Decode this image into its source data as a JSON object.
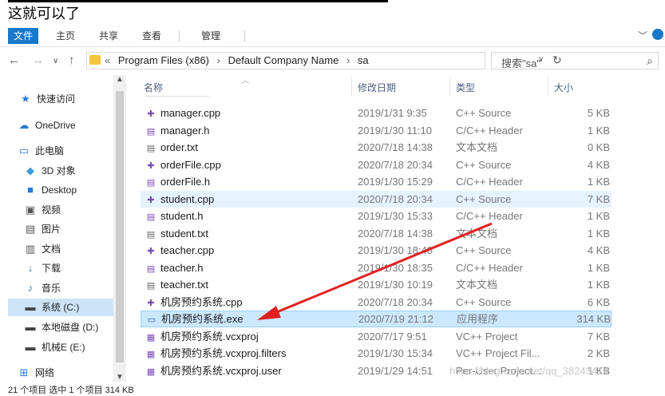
{
  "caption": "这就可以了",
  "ribbon": {
    "tabs": [
      "文件",
      "主页",
      "共享",
      "查看",
      "管理"
    ]
  },
  "address": {
    "crumbs": [
      "Program Files (x86)",
      "Default Company Name",
      "sa"
    ],
    "search_placeholder": "搜索\"sa\""
  },
  "nav": {
    "items": [
      {
        "label": "快速访问",
        "icon": "star-icon"
      },
      {
        "label": "OneDrive",
        "icon": "cloud-icon"
      },
      {
        "label": "此电脑",
        "icon": "computer-icon"
      },
      {
        "label": "3D 对象",
        "icon": "cube-icon"
      },
      {
        "label": "Desktop",
        "icon": "desktop-icon"
      },
      {
        "label": "视频",
        "icon": "video-icon"
      },
      {
        "label": "图片",
        "icon": "picture-icon"
      },
      {
        "label": "文档",
        "icon": "document-icon"
      },
      {
        "label": "下载",
        "icon": "download-icon"
      },
      {
        "label": "音乐",
        "icon": "music-icon"
      },
      {
        "label": "系统 (C:)",
        "icon": "drive-icon"
      },
      {
        "label": "本地磁盘 (D:)",
        "icon": "drive-icon"
      },
      {
        "label": "机械E (E:)",
        "icon": "drive-icon"
      },
      {
        "label": "网络",
        "icon": "network-icon"
      }
    ]
  },
  "columns": {
    "name": "名称",
    "date": "修改日期",
    "type": "类型",
    "size": "大小"
  },
  "files": [
    {
      "name": "manager.cpp",
      "date": "2019/1/31 9:35",
      "type": "C++ Source",
      "size": "5 KB",
      "icon": "cpp"
    },
    {
      "name": "manager.h",
      "date": "2019/1/30 11:10",
      "type": "C/C++ Header",
      "size": "1 KB",
      "icon": "h"
    },
    {
      "name": "order.txt",
      "date": "2020/7/18 14:38",
      "type": "文本文档",
      "size": "0 KB",
      "icon": "txt"
    },
    {
      "name": "orderFile.cpp",
      "date": "2020/7/18 20:34",
      "type": "C++ Source",
      "size": "4 KB",
      "icon": "cpp"
    },
    {
      "name": "orderFile.h",
      "date": "2019/1/30 15:29",
      "type": "C/C++ Header",
      "size": "1 KB",
      "icon": "h"
    },
    {
      "name": "student.cpp",
      "date": "2020/7/18 20:34",
      "type": "C++ Source",
      "size": "7 KB",
      "icon": "cpp"
    },
    {
      "name": "student.h",
      "date": "2019/1/30 15:33",
      "type": "C/C++ Header",
      "size": "1 KB",
      "icon": "h"
    },
    {
      "name": "student.txt",
      "date": "2020/7/18 14:38",
      "type": "文本文档",
      "size": "1 KB",
      "icon": "txt"
    },
    {
      "name": "teacher.cpp",
      "date": "2019/1/30 18:48",
      "type": "C++ Source",
      "size": "4 KB",
      "icon": "cpp"
    },
    {
      "name": "teacher.h",
      "date": "2019/1/30 18:35",
      "type": "C/C++ Header",
      "size": "1 KB",
      "icon": "h"
    },
    {
      "name": "teacher.txt",
      "date": "2019/1/30 10:19",
      "type": "文本文档",
      "size": "1 KB",
      "icon": "txt"
    },
    {
      "name": "机房预约系统.cpp",
      "date": "2020/7/18 20:34",
      "type": "C++ Source",
      "size": "6 KB",
      "icon": "cpp"
    },
    {
      "name": "机房预约系统.exe",
      "date": "2020/7/19 21:12",
      "type": "应用程序",
      "size": "314 KB",
      "icon": "exe"
    },
    {
      "name": "机房预约系统.vcxproj",
      "date": "2020/7/17 9:51",
      "type": "VC++ Project",
      "size": "7 KB",
      "icon": "proj"
    },
    {
      "name": "机房预约系统.vcxproj.filters",
      "date": "2019/1/30 15:34",
      "type": "VC++ Project Fil...",
      "size": "2 KB",
      "icon": "proj"
    },
    {
      "name": "机房预约系统.vcxproj.user",
      "date": "2019/1/29 14:51",
      "type": "Per-User Project...",
      "size": "1 KB",
      "icon": "proj"
    }
  ],
  "status": "21 个项目    选中 1 个项目  314 KB",
  "watermark": "https://blog.csdn.net/qq_38243414"
}
